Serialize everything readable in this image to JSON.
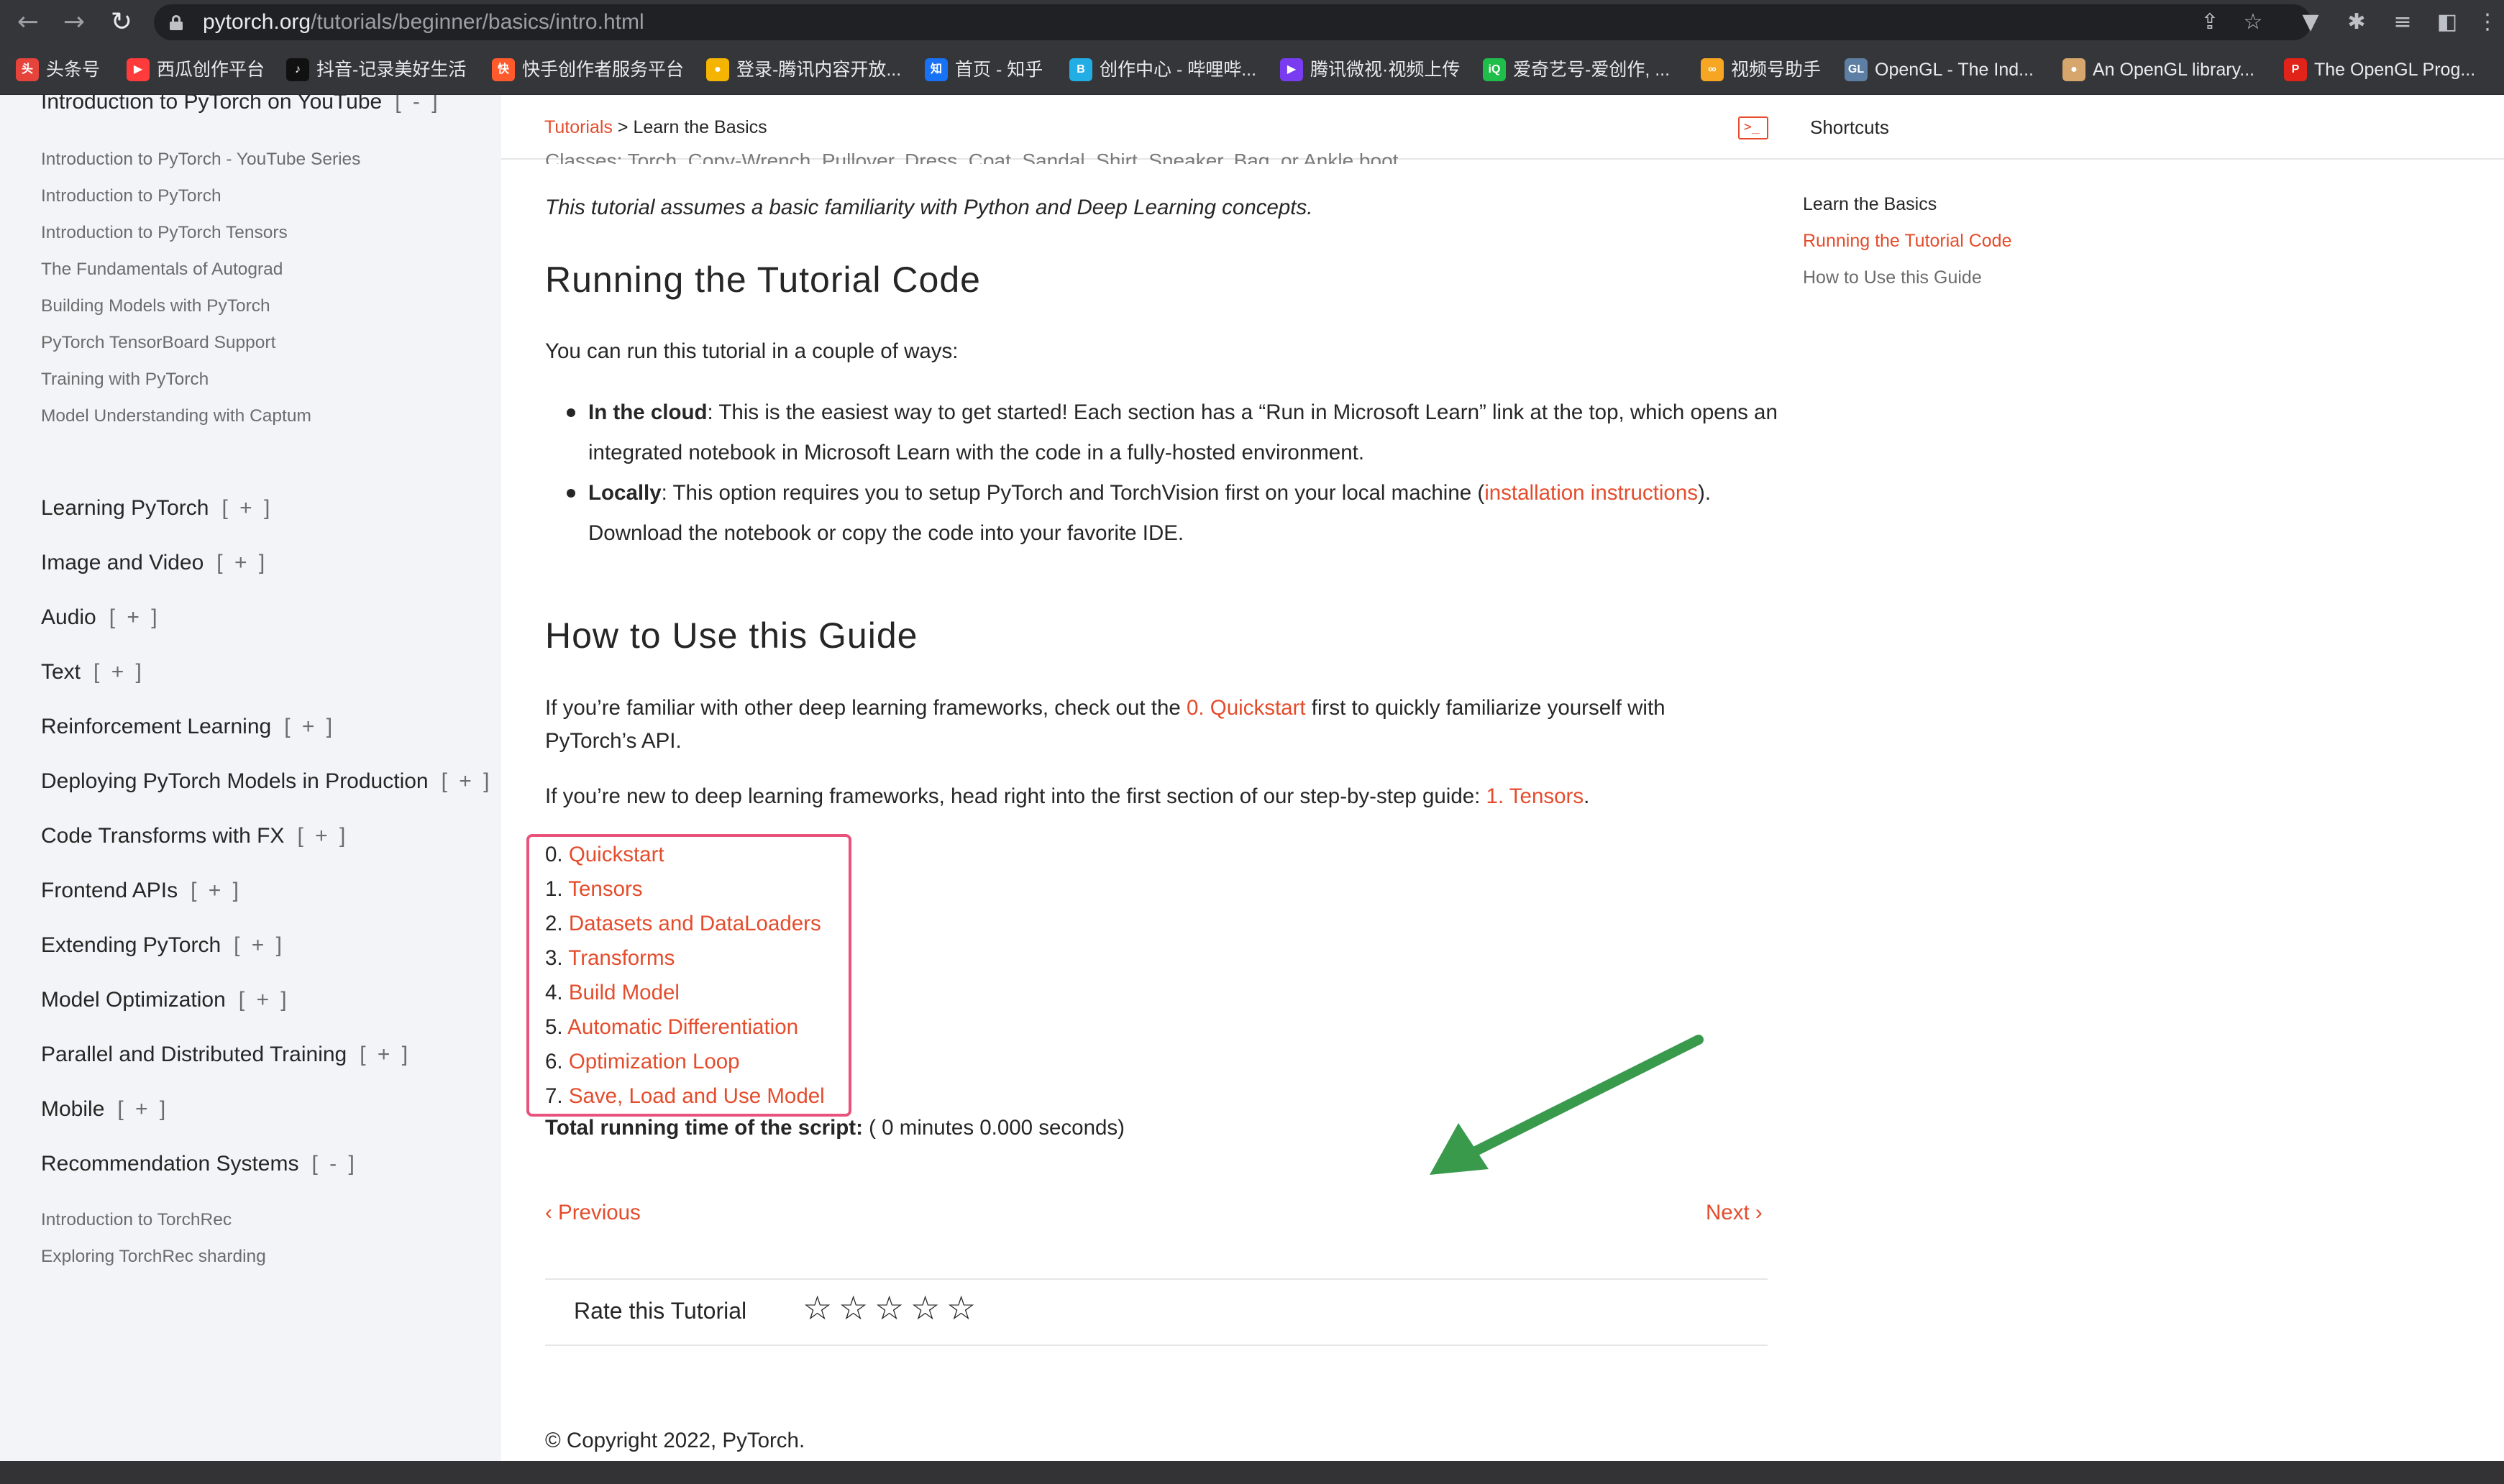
{
  "browser": {
    "url_host": "pytorch.org",
    "url_path": "/tutorials/beginner/basics/intro.html"
  },
  "bookmarks": [
    {
      "label": "头条号",
      "color": "#e6433b",
      "glyph": "头"
    },
    {
      "label": "西瓜创作平台",
      "color": "#ff3b3b",
      "glyph": "▶"
    },
    {
      "label": "抖音-记录美好生活",
      "color": "#111111",
      "glyph": "♪"
    },
    {
      "label": "快手创作者服务平台",
      "color": "#ff5a2c",
      "glyph": "快"
    },
    {
      "label": "登录-腾讯内容开放...",
      "color": "#f4b400",
      "glyph": "●"
    },
    {
      "label": "首页 - 知乎",
      "color": "#1772f6",
      "glyph": "知"
    },
    {
      "label": "创作中心 - 哔哩哔...",
      "color": "#23ade5",
      "glyph": "B"
    },
    {
      "label": "腾讯微视·视频上传",
      "color": "#7a3cf0",
      "glyph": "▶"
    },
    {
      "label": "爱奇艺号-爱创作, ...",
      "color": "#1fbd4a",
      "glyph": "iQ"
    },
    {
      "label": "视频号助手",
      "color": "#f6a623",
      "glyph": "∞"
    },
    {
      "label": "OpenGL - The Ind...",
      "color": "#5d7fa3",
      "glyph": "GL"
    },
    {
      "label": "An OpenGL library...",
      "color": "#d6a66c",
      "glyph": "●"
    },
    {
      "label": "The OpenGL Prog...",
      "color": "#e2231a",
      "glyph": "P"
    }
  ],
  "sidebar": {
    "top_section": {
      "label": "Introduction to PyTorch on YouTube",
      "toggle": "[ - ]"
    },
    "top_sub": [
      "Introduction to PyTorch - YouTube Series",
      "Introduction to PyTorch",
      "Introduction to PyTorch Tensors",
      "The Fundamentals of Autograd",
      "Building Models with PyTorch",
      "PyTorch TensorBoard Support",
      "Training with PyTorch",
      "Model Understanding with Captum"
    ],
    "sections": [
      {
        "label": "Learning PyTorch",
        "toggle": "[ + ]"
      },
      {
        "label": "Image and Video",
        "toggle": "[ + ]"
      },
      {
        "label": "Audio",
        "toggle": "[ + ]"
      },
      {
        "label": "Text",
        "toggle": "[ + ]"
      },
      {
        "label": "Reinforcement Learning",
        "toggle": "[ + ]"
      },
      {
        "label": "Deploying PyTorch Models in Production",
        "toggle": "[ + ]"
      },
      {
        "label": "Code Transforms with FX",
        "toggle": "[ + ]"
      },
      {
        "label": "Frontend APIs",
        "toggle": "[ + ]"
      },
      {
        "label": "Extending PyTorch",
        "toggle": "[ + ]"
      },
      {
        "label": "Model Optimization",
        "toggle": "[ + ]"
      },
      {
        "label": "Parallel and Distributed Training",
        "toggle": "[ + ]"
      },
      {
        "label": "Mobile",
        "toggle": "[ + ]"
      },
      {
        "label": "Recommendation Systems",
        "toggle": "[ - ]"
      }
    ],
    "rec_sub": [
      "Introduction to TorchRec",
      "Exploring TorchRec sharding"
    ]
  },
  "header": {
    "breadcrumb_link": "Tutorials",
    "breadcrumb_sep": " > ",
    "breadcrumb_current": "Learn the Basics",
    "shortcuts": "Shortcuts"
  },
  "article": {
    "cut_line": "Classes: Torch, Copy-Wrench, Pullover, Dress, Coat, Sandal, Shirt, Sneaker, Bag, or Ankle boot.",
    "assumption": "This tutorial assumes a basic familiarity with Python and Deep Learning concepts.",
    "h_running": "Running the Tutorial Code",
    "p_ways": "You can run this tutorial in a couple of ways:",
    "cloud_bold": "In the cloud",
    "cloud_text": ": This is the easiest way to get started! Each section has a “Run in Microsoft Learn” link at the top, which opens an",
    "cloud_text2": "integrated notebook in Microsoft Learn with the code in a fully-hosted environment.",
    "local_bold": "Locally",
    "local_text": ": This option requires you to setup PyTorch and TorchVision first on your local machine (",
    "local_link": "installation instructions",
    "local_text_end": ").",
    "local_text2": "Download the notebook or copy the code into your favorite IDE.",
    "h_guide": "How to Use this Guide",
    "p_familiar_a": "If you’re familiar with other deep learning frameworks, check out the ",
    "p_familiar_link": "0. Quickstart",
    "p_familiar_b": " first to quickly familiarize yourself with",
    "p_familiar_c": "PyTorch’s API.",
    "p_new_a": "If you’re new to deep learning frameworks, head right into the first section of our step-by-step guide: ",
    "p_new_link": "1. Tensors",
    "p_new_b": ".",
    "toc": [
      {
        "num": "0. ",
        "label": "Quickstart"
      },
      {
        "num": "1. ",
        "label": "Tensors"
      },
      {
        "num": "2. ",
        "label": "Datasets and DataLoaders"
      },
      {
        "num": "3. ",
        "label": "Transforms"
      },
      {
        "num": "4. ",
        "label": "Build Model"
      },
      {
        "num": "5. ",
        "label": "Automatic Differentiation"
      },
      {
        "num": "6. ",
        "label": "Optimization Loop"
      },
      {
        "num": "7. ",
        "label": "Save, Load and Use Model"
      }
    ],
    "running_bold": "Total running time of the script:",
    "running_text": " ( 0 minutes 0.000 seconds)",
    "prev": "Previous",
    "next": "Next",
    "rate_label": "Rate this Tutorial",
    "rating_stars_filled": 0,
    "rating_stars_total": 5,
    "copyright": "© Copyright 2022, PyTorch."
  },
  "right_toc": {
    "title": "Learn the Basics",
    "items": [
      "Running the Tutorial Code",
      "How to Use this Guide"
    ]
  },
  "colors": {
    "accent": "#e44c2c",
    "highlight_box": "#e8527b",
    "annotation_arrow": "#3a9a4c",
    "sidebar_bg": "#f3f4f7"
  }
}
